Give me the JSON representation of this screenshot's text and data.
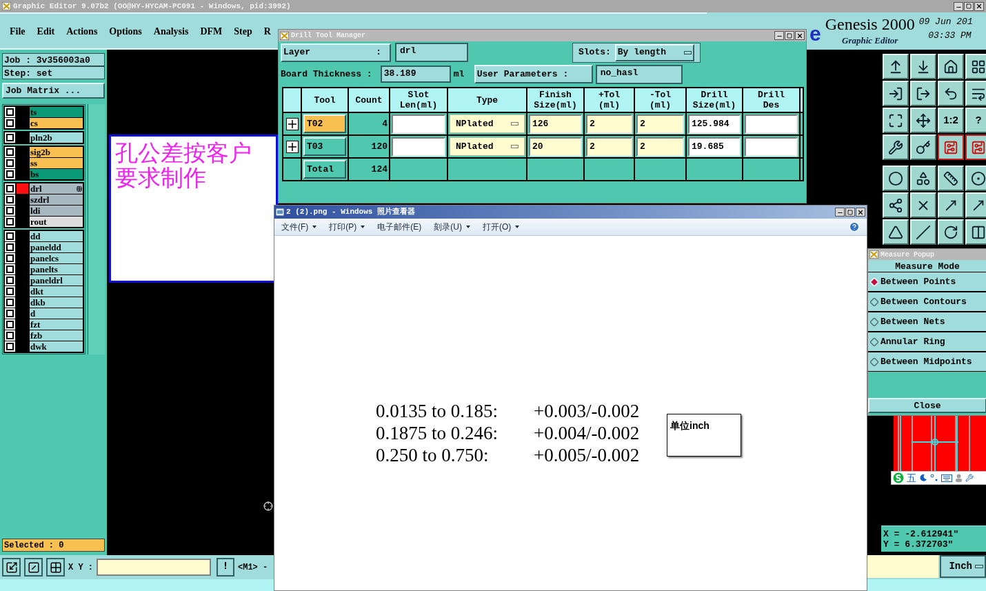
{
  "app": {
    "title": "Graphic Editor 9.07b2 (OO@HY-HYCAM-PC091 - Windows, pid:3992)",
    "menu": [
      "File",
      "Edit",
      "Actions",
      "Options",
      "Analysis",
      "DFM",
      "Step",
      "R"
    ]
  },
  "header": {
    "logo_letter": "e",
    "product": "Genesis 2000",
    "subtitle": "Graphic Editor",
    "date": "09 Jun 201",
    "time": "03:33 PM"
  },
  "job_panel": {
    "job": "Job : 3v356003a0",
    "step": "Step: set",
    "matrix_button": "Job Matrix ...",
    "selected_count": "Selected : 0",
    "layer_groups": [
      {
        "layers": [
          {
            "name": "ts",
            "color": "#0a9a78",
            "selected": false,
            "checked": false
          },
          {
            "name": "cs",
            "color": "#f8c050",
            "selected": false,
            "checked": false
          }
        ]
      },
      {
        "layers": [
          {
            "name": "pln2b",
            "color": "#a0dcdc",
            "selected": false,
            "checked": false
          }
        ]
      },
      {
        "layers": [
          {
            "name": "sig2b",
            "color": "#f8c050",
            "selected": false,
            "checked": false
          },
          {
            "name": "ss",
            "color": "#f8c050",
            "selected": false,
            "checked": false
          },
          {
            "name": "bs",
            "color": "#0a9a78",
            "selected": false,
            "checked": false
          }
        ]
      },
      {
        "layers": [
          {
            "name": "drl",
            "color": "#a8b8c0",
            "selected": true,
            "checked": false
          },
          {
            "name": "szdrl",
            "color": "#a8b8c0",
            "selected": false,
            "checked": false
          },
          {
            "name": "ldi",
            "color": "#a8b8c0",
            "selected": false,
            "checked": false
          },
          {
            "name": "rout",
            "color": "#dcdcdc",
            "selected": false,
            "checked": false
          }
        ]
      },
      {
        "layers": [
          {
            "name": "dd",
            "color": "#a0dcdc",
            "selected": false,
            "checked": false
          },
          {
            "name": "paneldd",
            "color": "#a0dcdc",
            "selected": false,
            "checked": false
          },
          {
            "name": "panelcs",
            "color": "#a0dcdc",
            "selected": false,
            "checked": false
          },
          {
            "name": "panelts",
            "color": "#a0dcdc",
            "selected": false,
            "checked": false
          },
          {
            "name": "paneldrl",
            "color": "#a0dcdc",
            "selected": false,
            "checked": false
          },
          {
            "name": "dkt",
            "color": "#a0dcdc",
            "selected": false,
            "checked": false
          },
          {
            "name": "dkb",
            "color": "#a0dcdc",
            "selected": false,
            "checked": false
          },
          {
            "name": "d",
            "color": "#a0dcdc",
            "selected": false,
            "checked": false
          },
          {
            "name": "fzt",
            "color": "#a0dcdc",
            "selected": false,
            "checked": false
          },
          {
            "name": "fzb",
            "color": "#a0dcdc",
            "selected": false,
            "checked": false
          },
          {
            "name": "dwk",
            "color": "#a0dcdc",
            "selected": false,
            "checked": false
          }
        ]
      }
    ]
  },
  "note": {
    "text": "孔公差按客户要求制作"
  },
  "drill_manager": {
    "title": "Drill Tool Manager",
    "layer_label": "Layer",
    "layer_colon": ":",
    "layer": "drl",
    "slots_label": "Slots:",
    "slots": "By length",
    "thickness_label": "Board Thickness :",
    "thickness": "38.189",
    "thickness_unit": "ml",
    "user_params_button": "User Parameters :",
    "user_params": "no_hasl",
    "columns": [
      "Tool",
      "Count",
      "Slot\nLen(ml)",
      "Type",
      "Finish\nSize(ml)",
      "+Tol\n(ml)",
      "-Tol\n(ml)",
      "Drill\nSize(ml)",
      "Drill\nDes"
    ],
    "rows": [
      {
        "tool": "T02",
        "count": "4",
        "type": "NPlated",
        "finish": "126",
        "plus_tol": "2",
        "minus_tol": "2",
        "drill_size": "125.984",
        "selected": true
      },
      {
        "tool": "T03",
        "count": "120",
        "type": "NPlated",
        "finish": "20",
        "plus_tol": "2",
        "minus_tol": "2",
        "drill_size": "19.685",
        "selected": false
      }
    ],
    "total": {
      "label": "Total",
      "count": "124"
    }
  },
  "photo_viewer": {
    "title": "2 (2).png - Windows 照片查看器",
    "menu": [
      {
        "label": "文件(F)",
        "dropdown": true
      },
      {
        "label": "打印(P)",
        "dropdown": true
      },
      {
        "label": "电子邮件(E)",
        "dropdown": false
      },
      {
        "label": "刻录(U)",
        "dropdown": true
      },
      {
        "label": "打开(O)",
        "dropdown": true
      }
    ],
    "document": {
      "rows": [
        {
          "range": "0.0135 to 0.185:",
          "tolerance": "+0.003/-0.002"
        },
        {
          "range": "0.1875 to 0.246:",
          "tolerance": "+0.004/-0.002"
        },
        {
          "range": "0.250 to 0.750:",
          "tolerance": "+0.005/-0.002"
        }
      ],
      "callout": "单位inch"
    }
  },
  "tool_grid": {
    "ratio_label": "1:2",
    "help_label": "?"
  },
  "measure_popup": {
    "title": "Measure Popup",
    "heading": "Measure Mode",
    "options": [
      {
        "label": "Between Points",
        "selected": true
      },
      {
        "label": "Between Contours",
        "selected": false
      },
      {
        "label": "Between Nets",
        "selected": false
      },
      {
        "label": "Annular Ring",
        "selected": false
      },
      {
        "label": "Between Midpoints",
        "selected": false
      }
    ],
    "close_button": "Close"
  },
  "ime_bar": {
    "label": "五"
  },
  "coordinates": {
    "x": "X = -2.612941\"",
    "y": "Y = 6.372703\""
  },
  "units": {
    "label": "Inch"
  },
  "bottom_toolbar": {
    "xy_label": "X Y :",
    "alert_button": "!",
    "mouse_label": "<M1> -"
  }
}
